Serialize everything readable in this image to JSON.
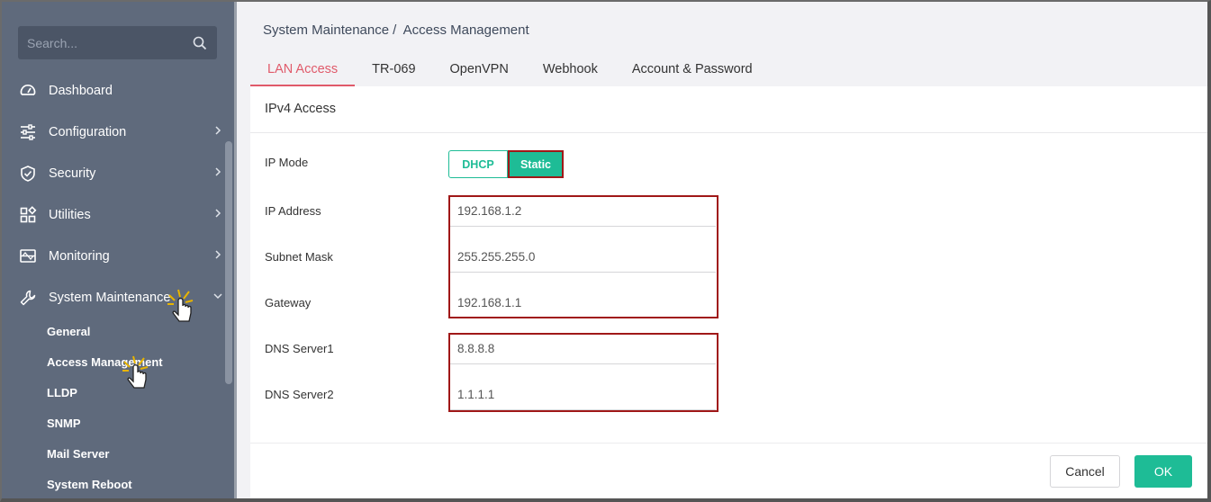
{
  "sidebar": {
    "search_placeholder": "Search...",
    "items": [
      {
        "label": "Dashboard",
        "icon": "dashboard-icon",
        "has_arrow": false
      },
      {
        "label": "Configuration",
        "icon": "sliders-icon",
        "has_arrow": true
      },
      {
        "label": "Security",
        "icon": "shield-check-icon",
        "has_arrow": true
      },
      {
        "label": "Utilities",
        "icon": "grid-icon",
        "has_arrow": true
      },
      {
        "label": "Monitoring",
        "icon": "monitor-icon",
        "has_arrow": true
      },
      {
        "label": "System Maintenance",
        "icon": "wrench-icon",
        "has_arrow": true,
        "expanded": true
      }
    ],
    "sub_items": [
      "General",
      "Access Management",
      "LLDP",
      "SNMP",
      "Mail Server",
      "System Reboot"
    ]
  },
  "breadcrumb": {
    "parent": "System Maintenance",
    "separator": "/",
    "current": "Access Management"
  },
  "tabs": [
    "LAN Access",
    "TR-069",
    "OpenVPN",
    "Webhook",
    "Account & Password"
  ],
  "active_tab": "LAN Access",
  "card": {
    "title": "IPv4 Access",
    "ip_mode": {
      "label": "IP Mode",
      "options": [
        "DHCP",
        "Static"
      ],
      "selected": "Static"
    },
    "fields": [
      {
        "label": "IP Address",
        "value": "192.168.1.2"
      },
      {
        "label": "Subnet Mask",
        "value": "255.255.255.0"
      },
      {
        "label": "Gateway",
        "value": "192.168.1.1"
      },
      {
        "label": "DNS Server1",
        "value": "8.8.8.8"
      },
      {
        "label": "DNS Server2",
        "value": "1.1.1.1"
      }
    ]
  },
  "footer": {
    "cancel_label": "Cancel",
    "ok_label": "OK"
  },
  "colors": {
    "accent": "#1ebc96",
    "active_tab": "#e05a6a",
    "highlight": "#a01818",
    "sidebar_bg": "#5f6a7c"
  }
}
